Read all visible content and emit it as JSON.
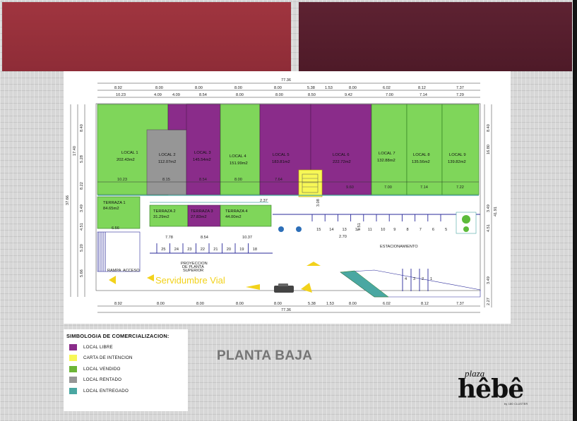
{
  "plan": {
    "top_dims_row1": [
      "8.92",
      "8.00",
      "8.00",
      "8.00",
      "8.00",
      "5.38",
      "1.53",
      "8.00",
      "6.02",
      "8.12",
      "7.37"
    ],
    "top_dims_row2": [
      "10.23",
      "4.09",
      "4.09",
      "8.54",
      "8.00",
      "8.00",
      "8.50",
      "9.42",
      "7.00",
      "7.14",
      "7.29"
    ],
    "total_width": "77.36",
    "bottom_dims": [
      "8.92",
      "8.00",
      "8.00",
      "8.00",
      "8.00",
      "5.38",
      "1.53",
      "8.00",
      "6.02",
      "8.12",
      "7.37"
    ],
    "left_dims_outer": [
      "17.40",
      "37.66"
    ],
    "left_dims_inner": [
      "8.40",
      "5.28",
      "8.22",
      "3.49",
      "4.51",
      "5.20",
      "5.66"
    ],
    "right_dims": [
      "8.40",
      "16.80",
      "3.49",
      "41.91",
      "4.51",
      "3.49",
      "2.27"
    ],
    "locals": [
      {
        "name": "LOCAL 1",
        "area": "202.43m2",
        "width_label": "10.23"
      },
      {
        "name": "LOCAL 2",
        "area": "112.07m2",
        "width_label": "8.15"
      },
      {
        "name": "LOCAL 3",
        "area": "145.54m2",
        "width_label": "8.54"
      },
      {
        "name": "LOCAL 4",
        "area": "151.99m2",
        "width_label": "8.00"
      },
      {
        "name": "LOCAL 5",
        "area": "183.81m2",
        "width_label": "7.64"
      },
      {
        "name": "LOCAL 6",
        "area": "222.72m2",
        "width_label": "9.60"
      },
      {
        "name": "LOCAL 7",
        "area": "132.88m2",
        "width_label": "7.00"
      },
      {
        "name": "LOCAL 8",
        "area": "135.56m2",
        "width_label": "7.14"
      },
      {
        "name": "LOCAL 9",
        "area": "139.82m2",
        "width_label": "7.22"
      }
    ],
    "terrazas": [
      {
        "name": "TERRAZA 1",
        "area": "84.65m2"
      },
      {
        "name": "TERRAZA 2",
        "area": "31.29m2"
      },
      {
        "name": "TERRAZA 3",
        "area": "27.83m2"
      },
      {
        "name": "TERRAZA 4",
        "area": "44.00m2"
      }
    ],
    "misc_dims": {
      "d237": "2.37",
      "d308": "3.08",
      "d778": "7.78",
      "d854": "8.54",
      "d1037": "10.37",
      "d270": "2.70",
      "d151": "1.51",
      "d656": "6.56"
    },
    "stalls_upper": [
      "15",
      "14",
      "13",
      "12",
      "11",
      "10",
      "9",
      "8",
      "7",
      "6",
      "5"
    ],
    "stalls_lower": [
      "25",
      "24",
      "23",
      "22",
      "21",
      "20",
      "19",
      "18"
    ],
    "stalls_lot": [
      "4",
      "3",
      "2",
      "1"
    ],
    "estacionamiento": "ESTACIONAMIENTO",
    "servidumbre": "Servidumbre Vial",
    "proyeccion": [
      "PROYECCION",
      "DE PLANTA",
      "SUPERIOR"
    ],
    "rampa": "RAMPA",
    "acceso": "ACCESO"
  },
  "legend": {
    "title": "SIMBOLOGIA DE COMERCIALIZACION:",
    "items": [
      {
        "label": "LOCAL LIBRE",
        "color": "#8a2c8a"
      },
      {
        "label": "CARTA DE INTENCION",
        "color": "#f7f756"
      },
      {
        "label": "LOCAL VENDIDO",
        "color": "#6cb536"
      },
      {
        "label": "LOCAL RENTADO",
        "color": "#969696"
      },
      {
        "label": "LOCAL ENTREGADO",
        "color": "#4aa7a2"
      }
    ]
  },
  "page": {
    "title": "PLANTA BAJA"
  },
  "brand": {
    "small": "plaza",
    "name": "hêbê",
    "tagline": "by 180 CLUSTER"
  },
  "colors": {
    "libre": "#8a2c8a",
    "vendido": "#7fd65a",
    "rentado": "#969696",
    "carta": "#f7f756",
    "entregado": "#4aa7a2",
    "bar_left": "#a0353f",
    "bar_right": "#5e2232"
  }
}
